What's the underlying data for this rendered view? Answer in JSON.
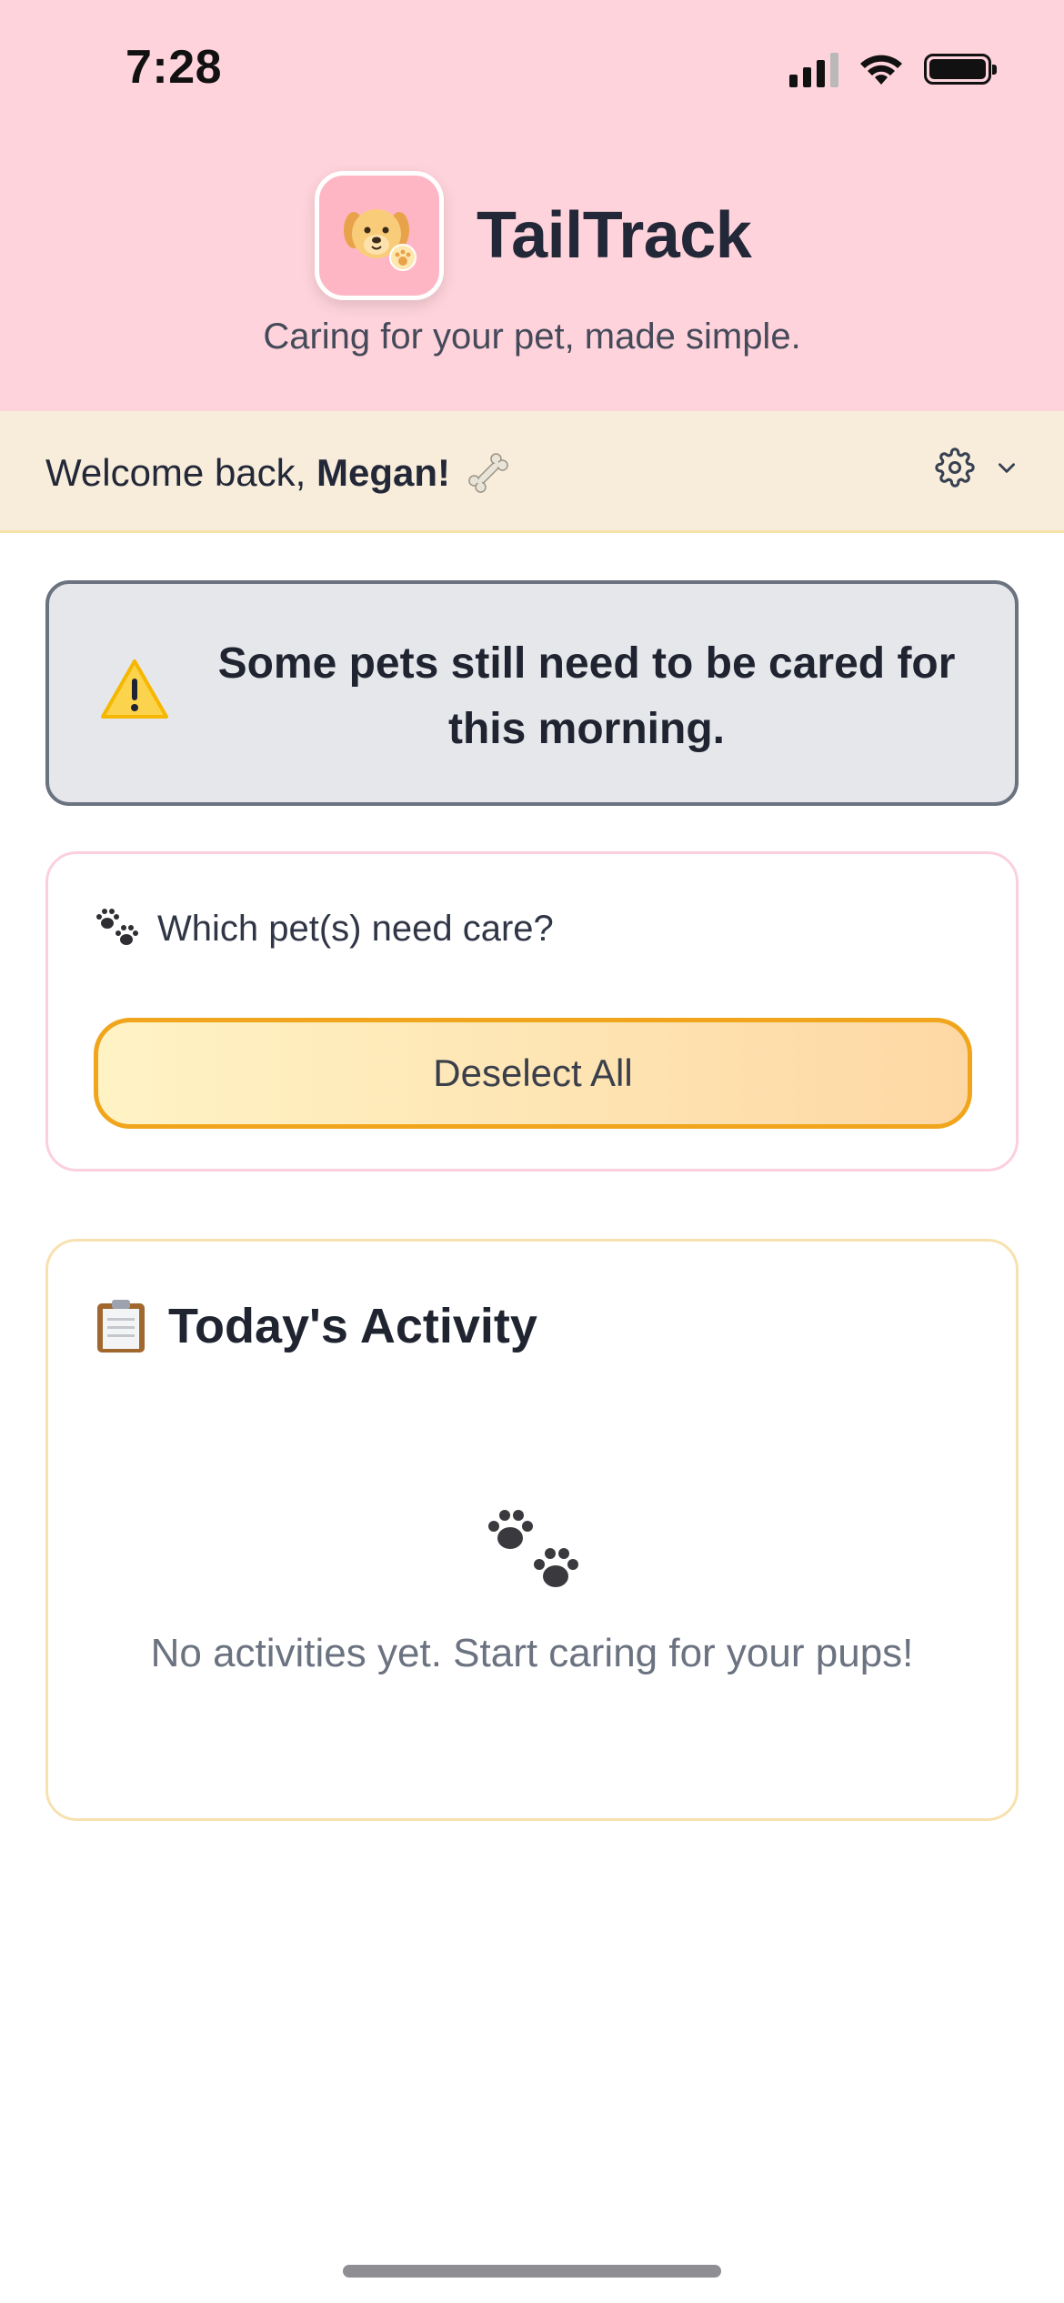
{
  "status_bar": {
    "time": "7:28"
  },
  "header": {
    "app_name": "TailTrack",
    "tagline": "Caring for your pet, made simple."
  },
  "welcome": {
    "prefix": "Welcome back, ",
    "name": "Megan!"
  },
  "alert": {
    "message": "Some pets still need to be cared for this morning."
  },
  "pet_selection": {
    "label": "Which pet(s) need care?",
    "deselect_label": "Deselect All"
  },
  "activity": {
    "title": "Today's Activity",
    "empty_message": "No activities yet. Start caring for your pups!"
  },
  "icons": {
    "app": "dog-face-icon",
    "bone": "bone-icon",
    "settings": "gear-icon",
    "dropdown": "chevron-down-icon",
    "warning": "warning-icon",
    "paws": "paw-prints-icon",
    "clipboard": "clipboard-icon"
  },
  "colors": {
    "header_bg": "#ffd3db",
    "welcome_bg": "#f8eddb",
    "alert_bg": "#e5e7eb",
    "alert_border": "#6b7280",
    "button_border": "#f0a51c",
    "pet_card_border": "#fbd0dc",
    "activity_card_border": "#f8e1b0"
  }
}
